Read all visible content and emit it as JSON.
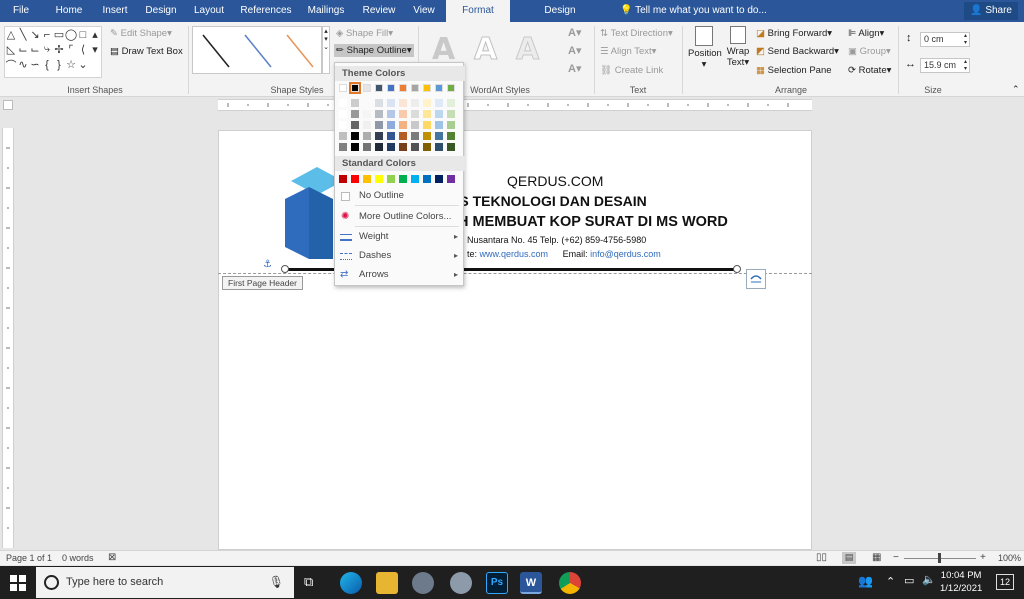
{
  "tabs": [
    "File",
    "Home",
    "Insert",
    "Design",
    "Layout",
    "References",
    "Mailings",
    "Review",
    "View",
    "Format",
    "Design"
  ],
  "active_tab": "Format",
  "tell_me": "Tell me what you want to do...",
  "share": "Share",
  "ribbon": {
    "insert_shapes": {
      "label": "Insert Shapes",
      "edit_shape": "Edit Shape",
      "draw_text_box": "Draw Text Box"
    },
    "shape_styles": {
      "label": "Shape Styles",
      "shape_fill": "Shape Fill",
      "shape_outline": "Shape Outline"
    },
    "wordart": {
      "label": "WordArt Styles",
      "letter": "A"
    },
    "text": {
      "label": "Text",
      "text_direction": "Text Direction",
      "align_text": "Align Text",
      "create_link": "Create Link"
    },
    "arrange": {
      "label": "Arrange",
      "position": "Position",
      "wrap_text": "Wrap Text",
      "bring_forward": "Bring Forward",
      "send_backward": "Send Backward",
      "selection_pane": "Selection Pane",
      "align": "Align",
      "group": "Group",
      "rotate": "Rotate"
    },
    "size": {
      "label": "Size",
      "height": "0 cm",
      "width": "15.9 cm"
    }
  },
  "dropdown": {
    "theme_colors_label": "Theme Colors",
    "standard_colors_label": "Standard Colors",
    "no_outline": "No Outline",
    "more_outline_colors": "More Outline Colors...",
    "weight": "Weight",
    "dashes": "Dashes",
    "arrows": "Arrows",
    "theme_colors": [
      "#ffffff",
      "#000000",
      "#e7e6e6",
      "#44546a",
      "#4472c4",
      "#ed7d31",
      "#a5a5a5",
      "#ffc000",
      "#5b9bd5",
      "#70ad47"
    ],
    "standard_colors": [
      "#c00000",
      "#ff0000",
      "#ffc000",
      "#ffff00",
      "#92d050",
      "#00b050",
      "#00b0f0",
      "#0070c0",
      "#002060",
      "#7030a0"
    ]
  },
  "document": {
    "site": "QERDUS.COM",
    "line1": "PS TEKNOLOGI DAN DESAIN",
    "line2": "H MEMBUAT KOP SURAT DI MS WORD",
    "address": "Nusantara No. 45 Telp. (+62) 859-4756-5980",
    "website_prefix": "te: ",
    "website": "www.qerdus.com",
    "email_prefix": "Email: ",
    "email": "info@qerdus.com",
    "header_tag": "First Page Header",
    "logo_color": "#2f6cbd"
  },
  "status": {
    "page": "Page 1 of 1",
    "words": "0 words",
    "zoom": "100%"
  },
  "taskbar": {
    "search_placeholder": "Type here to search",
    "time": "10:04 PM",
    "date": "1/12/2021",
    "notifications": "12"
  }
}
